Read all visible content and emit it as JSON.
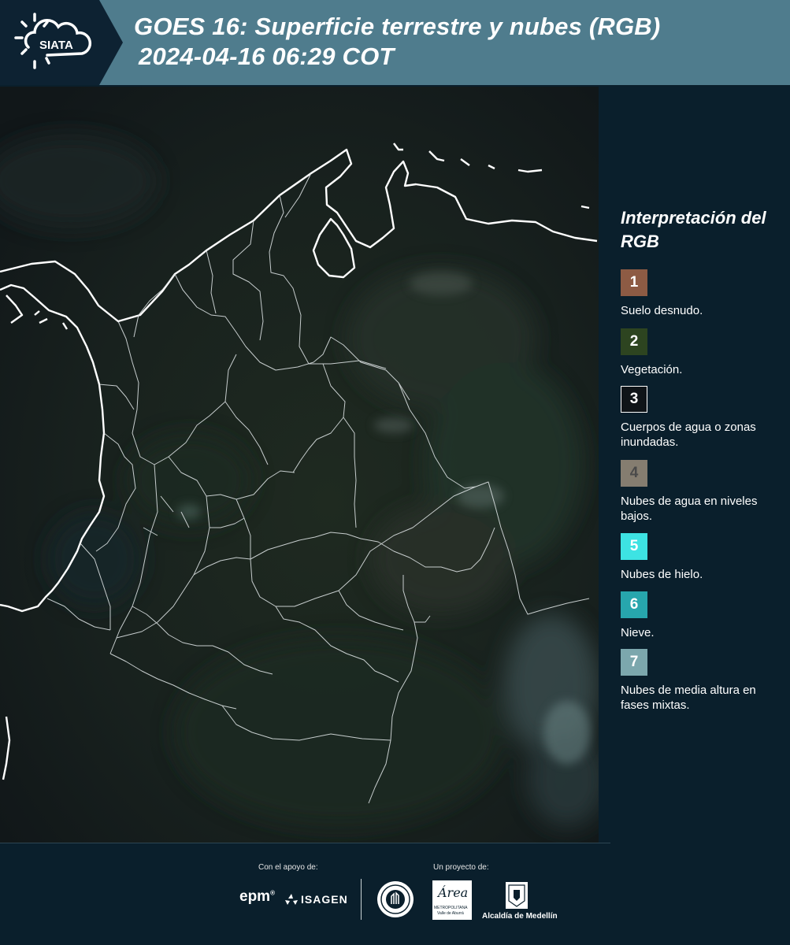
{
  "header": {
    "logo_text": "SIATA",
    "title_line1": "GOES 16: Superficie terrestre y nubes (RGB)",
    "title_line2": "2024-04-16 06:29 COT"
  },
  "legend": {
    "title": "Interpretación del RGB",
    "items": [
      {
        "number": "1",
        "label": "Suelo desnudo.",
        "color": "#8d5b44",
        "text_color": "#ffffff"
      },
      {
        "number": "2",
        "label": "Vegetación.",
        "color": "#2d4420",
        "text_color": "#ffffff"
      },
      {
        "number": "3",
        "label": "Cuerpos de agua o zonas inundadas.",
        "color": "#0f1418",
        "text_color": "#ffffff"
      },
      {
        "number": "4",
        "label": "Nubes de agua en niveles bajos.",
        "color": "#857d70",
        "text_color": "#4a4a4a"
      },
      {
        "number": "5",
        "label": "Nubes de hielo.",
        "color": "#3de3e3",
        "text_color": "#ffffff"
      },
      {
        "number": "6",
        "label": "Nieve.",
        "color": "#27a6ad",
        "text_color": "#ffffff"
      },
      {
        "number": "7",
        "label": "Nubes de media altura en fases mixtas.",
        "color": "#7ca7ad",
        "text_color": "#ffffff"
      }
    ]
  },
  "footer": {
    "support_label": "Con el apoyo de:",
    "project_label": "Un proyecto de:",
    "sponsors": [
      "epm",
      "ISAGEN"
    ],
    "area_logo_text": "Área",
    "area_logo_sub1": "METROPOLITANA",
    "area_logo_sub2": "Valle de Aburrá",
    "alcaldia_label": "Alcaldía de Medellín"
  }
}
